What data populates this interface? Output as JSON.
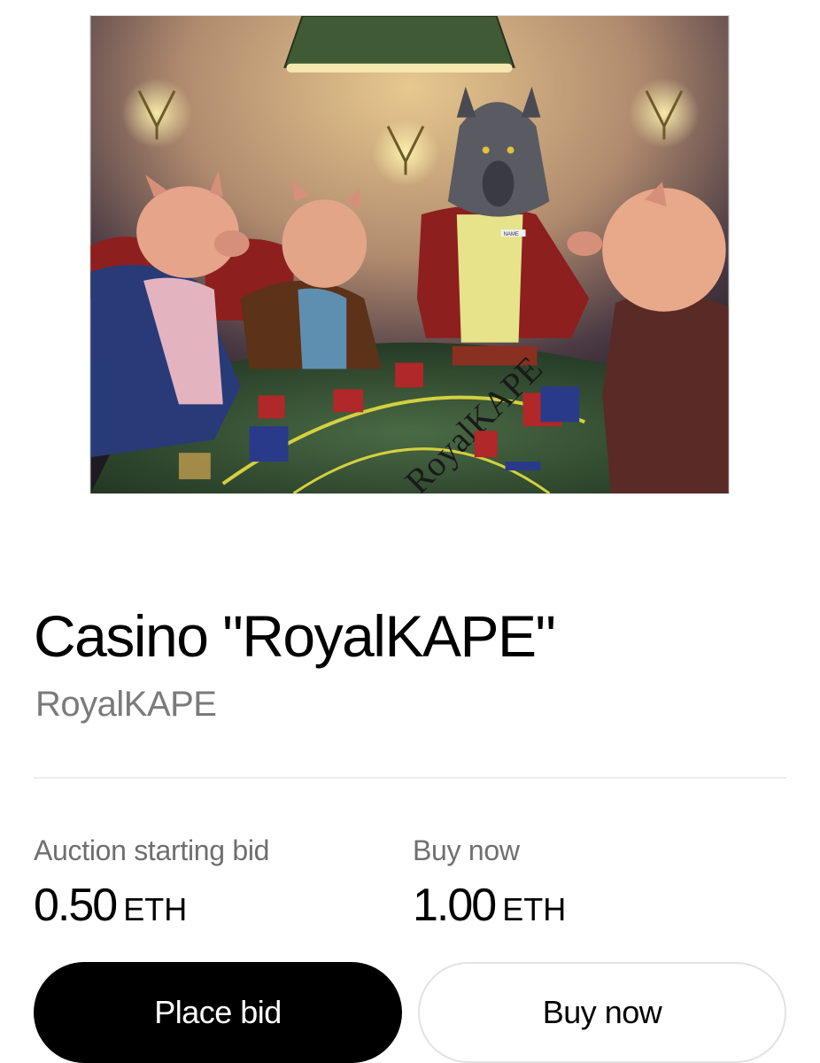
{
  "artwork": {
    "table_text": "RoyalKAPE",
    "name_tag": "NAME"
  },
  "nft": {
    "title": "Casino \"RoyalKAPE\"",
    "creator": "RoyalKAPE"
  },
  "pricing": {
    "auction": {
      "label": "Auction starting bid",
      "amount": "0.50",
      "unit": "ETH"
    },
    "buy_now": {
      "label": "Buy now",
      "amount": "1.00",
      "unit": "ETH"
    }
  },
  "actions": {
    "place_bid_label": "Place bid",
    "buy_now_label": "Buy now"
  },
  "colors": {
    "primary_button": "#000000",
    "secondary_text": "#7a7a7a",
    "table_felt": "#2f4a2e"
  }
}
